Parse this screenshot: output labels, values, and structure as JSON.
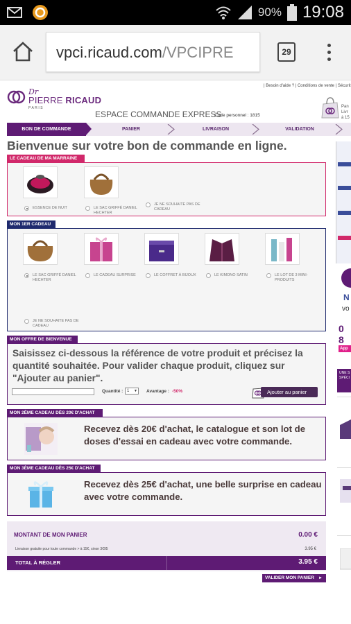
{
  "statusbar": {
    "battery_percent": "90%",
    "time": "19:08"
  },
  "browser": {
    "url_domain": "vpci.ricaud.com",
    "url_path": "/VPCIPRE",
    "tab_count": "29"
  },
  "header": {
    "logo_dr": "Dr",
    "logo_first": "PIERRE",
    "logo_last": "RICAUD",
    "logo_city": "PARIS",
    "top_links": "| Besoin d'aide ? | Conditions de vente | Sécurit",
    "espace_title": "ESPACE COMMANDE EXPRESS",
    "code_personnel": "Code personnel : 1815",
    "cart_side_lines": [
      "Pan",
      "Livr",
      "à 15"
    ]
  },
  "steps": [
    {
      "label": "BON DE COMMANDE",
      "active": true
    },
    {
      "label": "PANIER",
      "active": false
    },
    {
      "label": "LIVRAISON",
      "active": false
    },
    {
      "label": "VALIDATION",
      "active": false
    }
  ],
  "welcome": "Bienvenue sur votre bon de commande en ligne.",
  "marraine": {
    "title": "LE CADEAU DE MA MARRAINE",
    "options": [
      {
        "label": "ESSENCE DE NUIT",
        "selected": true
      },
      {
        "label": "LE SAC GRIFFÉ DANIEL HECHTER",
        "selected": false
      },
      {
        "label": "JE NE SOUHAITE PAS DE CADEAU",
        "selected": false
      }
    ]
  },
  "premier_cadeau": {
    "title": "MON 1ER CADEAU",
    "options": [
      {
        "label": "LE SAC GRIFFÉ DANIEL HECHTER",
        "selected": true
      },
      {
        "label": "LE CADEAU SURPRISE",
        "selected": false
      },
      {
        "label": "LE COFFRET À BIJOUX",
        "selected": false
      },
      {
        "label": "LE KIMONO SATIN",
        "selected": false
      },
      {
        "label": "LE LOT DE 3 MINI-PRODUITS",
        "selected": false
      },
      {
        "label": "JE NE SOUHAITE PAS DE CADEAU",
        "selected": false
      }
    ]
  },
  "offre": {
    "title": "MON OFFRE DE BIENVENUE",
    "text": "Saisissez ci-dessous la référence de votre produit et précisez la quantité souhaitée. Pour valider chaque produit, cliquez sur \"Ajouter au panier\".",
    "reference_value": "",
    "quantity_label": "Quantité :",
    "quantity_value": "1",
    "avantage_label": "Avantage :",
    "avantage_value": "-50%",
    "add_button": "Ajouter au panier"
  },
  "cadeau2": {
    "title": "MON 2ÈME CADEAU DÈS 20€ D'ACHAT",
    "text": "Recevez dès 20€ d'achat, le catalogue et son lot de doses d'essai en cadeau avec votre commande."
  },
  "cadeau3": {
    "title": "MON 3ÈME CADEAU DÈS 25€ D'ACHAT",
    "text": "Recevez dès 25€ d'achat, une belle surprise en cadeau avec votre commande."
  },
  "summary": {
    "montant_label": "MONTANT DE MON PANIER",
    "montant_value": "0.00 €",
    "livraison_label": "Livraison gratuite pour toute commande > à 15€, sinon 3€95",
    "livraison_value": "3.95 €",
    "total_label": "TOTAL À RÉGLER",
    "total_value": "3.95 €",
    "valider_button": "VALIDER MON PANIER"
  },
  "sidebar": {
    "n_text": "N",
    "vo_text": "vo",
    "phone_partial": "0 8",
    "app_text": "App",
    "promo_text": "UNE S SPÉCI"
  },
  "colors": {
    "brand_purple": "#5e1b74",
    "marraine_pink": "#d1286a",
    "section_navy": "#1f2a6e"
  }
}
